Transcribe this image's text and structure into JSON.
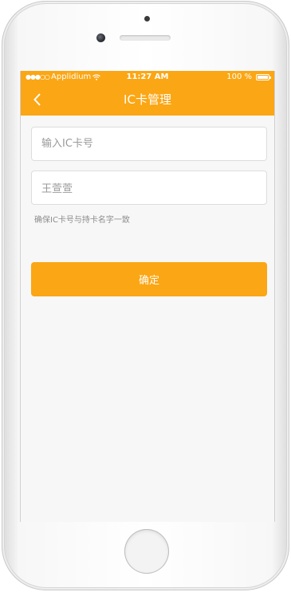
{
  "status_bar": {
    "signal": "●●●○○",
    "carrier": "Applidium",
    "time": "11:27 AM",
    "battery_percent": "100 %",
    "battery_level": 1.0
  },
  "nav": {
    "back_icon": "chevron-left-icon",
    "title": "IC卡管理"
  },
  "form": {
    "card_number_placeholder": "输入IC卡号",
    "card_holder_value": "王萱萱",
    "hint": "确保IC卡号与持卡名字一致",
    "confirm_label": "确定"
  },
  "colors": {
    "accent": "#fba614",
    "background": "#f7f7f7"
  }
}
